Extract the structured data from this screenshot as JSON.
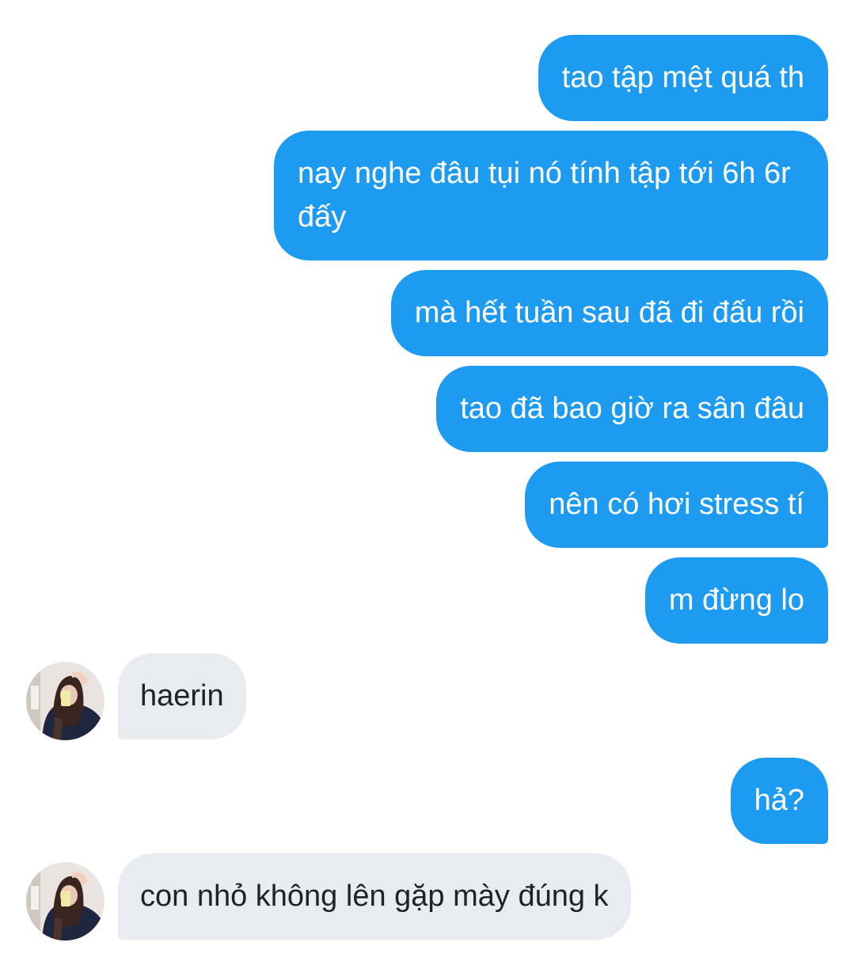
{
  "conversation": {
    "contact_name": "",
    "messages": [
      {
        "direction": "sent",
        "text": "tao tập mệt quá th"
      },
      {
        "direction": "sent",
        "text": "nay nghe đâu tụi nó tính tập tới 6h 6r đấy"
      },
      {
        "direction": "sent",
        "text": "mà hết tuần sau đã đi đấu rồi"
      },
      {
        "direction": "sent",
        "text": "tao đã bao giờ ra sân đâu"
      },
      {
        "direction": "sent",
        "text": "nên có hơi stress tí"
      },
      {
        "direction": "sent",
        "text": "m đừng lo"
      },
      {
        "direction": "received",
        "text": "haerin",
        "avatar": "user-avatar-photo"
      },
      {
        "direction": "sent",
        "text": "hả?"
      },
      {
        "direction": "received",
        "text": "con nhỏ không lên gặp mày đúng k",
        "avatar": "user-avatar-photo"
      }
    ]
  },
  "colors": {
    "sent_bubble": "#1d9bf0",
    "sent_text": "#ffffff",
    "received_bubble": "#e8ecf0",
    "received_text": "#1f2328",
    "background": "#ffffff"
  }
}
